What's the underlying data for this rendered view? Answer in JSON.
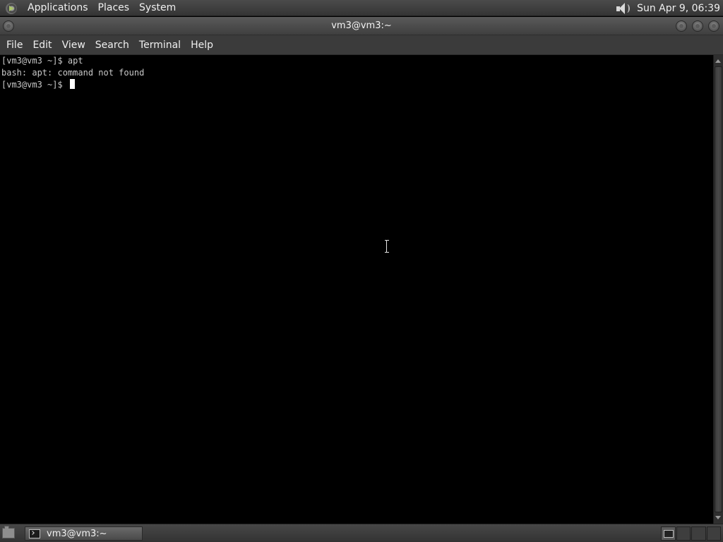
{
  "top_panel": {
    "menus": [
      "Applications",
      "Places",
      "System"
    ],
    "clock": "Sun Apr  9, 06:39"
  },
  "window": {
    "title": "vm3@vm3:~"
  },
  "menu_bar": {
    "items": [
      "File",
      "Edit",
      "View",
      "Search",
      "Terminal",
      "Help"
    ]
  },
  "terminal": {
    "lines": [
      "[vm3@vm3 ~]$ apt",
      "bash: apt: command not found",
      "[vm3@vm3 ~]$ "
    ]
  },
  "taskbar": {
    "tasks": [
      {
        "label": "vm3@vm3:~",
        "icon": "terminal-icon"
      }
    ]
  },
  "icons": {
    "os_logo": "gnome-foot-icon",
    "volume": "volume-icon",
    "show_desktop": "show-desktop-icon"
  }
}
